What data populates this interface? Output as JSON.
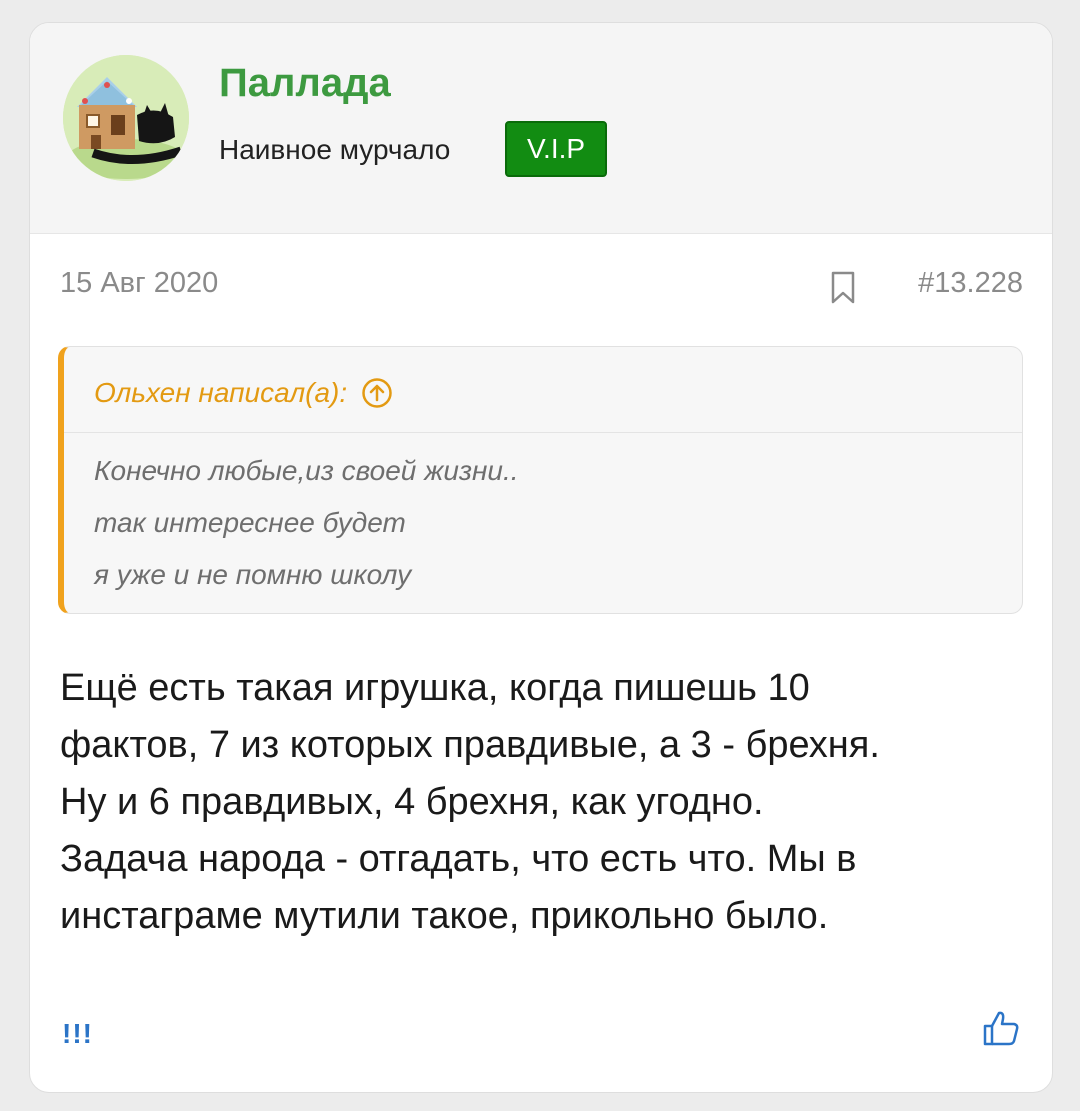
{
  "user": {
    "name": "Паллада",
    "title": "Наивное мурчало",
    "badge": "V.I.P"
  },
  "post": {
    "date": "15 Авг 2020",
    "number": "#13.228"
  },
  "quote": {
    "author": "Ольхен написал(а):",
    "lines": [
      "Конечно любые,из своей жизни..",
      "так интереснее будет",
      "я уже и не помню школу"
    ]
  },
  "message": {
    "lines": [
      "Ещё есть такая игрушка, когда пишешь 10",
      "фактов, 7 из которых правдивые, а 3 - брехня.",
      "Ну и 6 правдивых, 4 брехня, как угодно.",
      "Задача народа - отгадать, что есть что. Мы в",
      "инстаграме мутили такое, прикольно было."
    ]
  },
  "footer": {
    "reaction_text": "!!!"
  },
  "colors": {
    "username": "#3d9a40",
    "badge_bg": "#128c12",
    "quote_accent": "#f0a21d",
    "link": "#2b74c7"
  },
  "icons": {
    "bookmark": "bookmark-icon",
    "quote_expand": "arrow-up-circle-icon",
    "like": "thumbs-up-icon"
  }
}
